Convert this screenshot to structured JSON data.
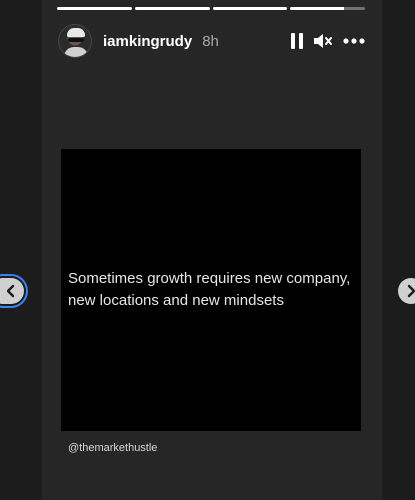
{
  "story": {
    "progress": [
      1,
      1,
      1,
      0.72
    ],
    "username": "iamkingrudy",
    "time": "8h",
    "content_text": "Sometimes growth requires new company,\nnew locations and new mindsets",
    "handle": "@themarkethustle"
  },
  "icons": {
    "pause": "pause-icon",
    "mute": "speaker-muted-icon",
    "more": "more-icon",
    "prev": "chevron-left-icon",
    "next": "chevron-right-icon"
  },
  "colors": {
    "page_bg": "#1c1c1c",
    "story_bg": "#262626",
    "content_bg": "#000000",
    "focus_ring": "#3b82f6"
  }
}
